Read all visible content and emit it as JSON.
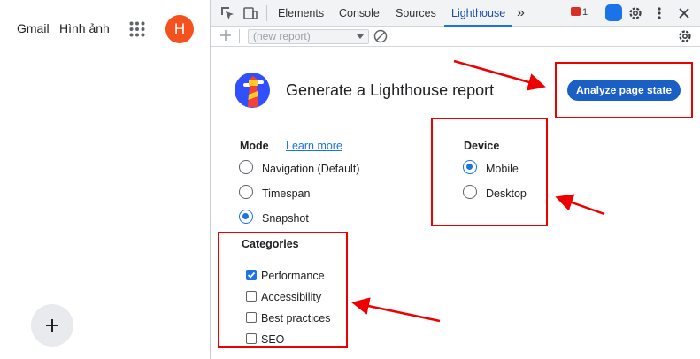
{
  "google": {
    "gmail": "Gmail",
    "images": "Hình ảnh",
    "avatar_letter": "H"
  },
  "devtools": {
    "tabs": [
      "Elements",
      "Console",
      "Sources",
      "Lighthouse"
    ],
    "more": "»",
    "issues_count": "1",
    "report_placeholder": "(new report)"
  },
  "lighthouse": {
    "title": "Generate a Lighthouse report",
    "analyze_button": "Analyze page state",
    "mode_label": "Mode",
    "learn_more": "Learn more",
    "modes": [
      {
        "label": "Navigation (Default)",
        "selected": false
      },
      {
        "label": "Timespan",
        "selected": false
      },
      {
        "label": "Snapshot",
        "selected": true
      }
    ],
    "device_label": "Device",
    "devices": [
      {
        "label": "Mobile",
        "selected": true
      },
      {
        "label": "Desktop",
        "selected": false
      }
    ],
    "categories_label": "Categories",
    "categories": [
      {
        "label": "Performance",
        "checked": true
      },
      {
        "label": "Accessibility",
        "checked": false
      },
      {
        "label": "Best practices",
        "checked": false
      },
      {
        "label": "SEO",
        "checked": false
      }
    ]
  },
  "colors": {
    "accent": "#1a73e8",
    "annotation": "#e00000",
    "avatar": "#f4511e"
  }
}
